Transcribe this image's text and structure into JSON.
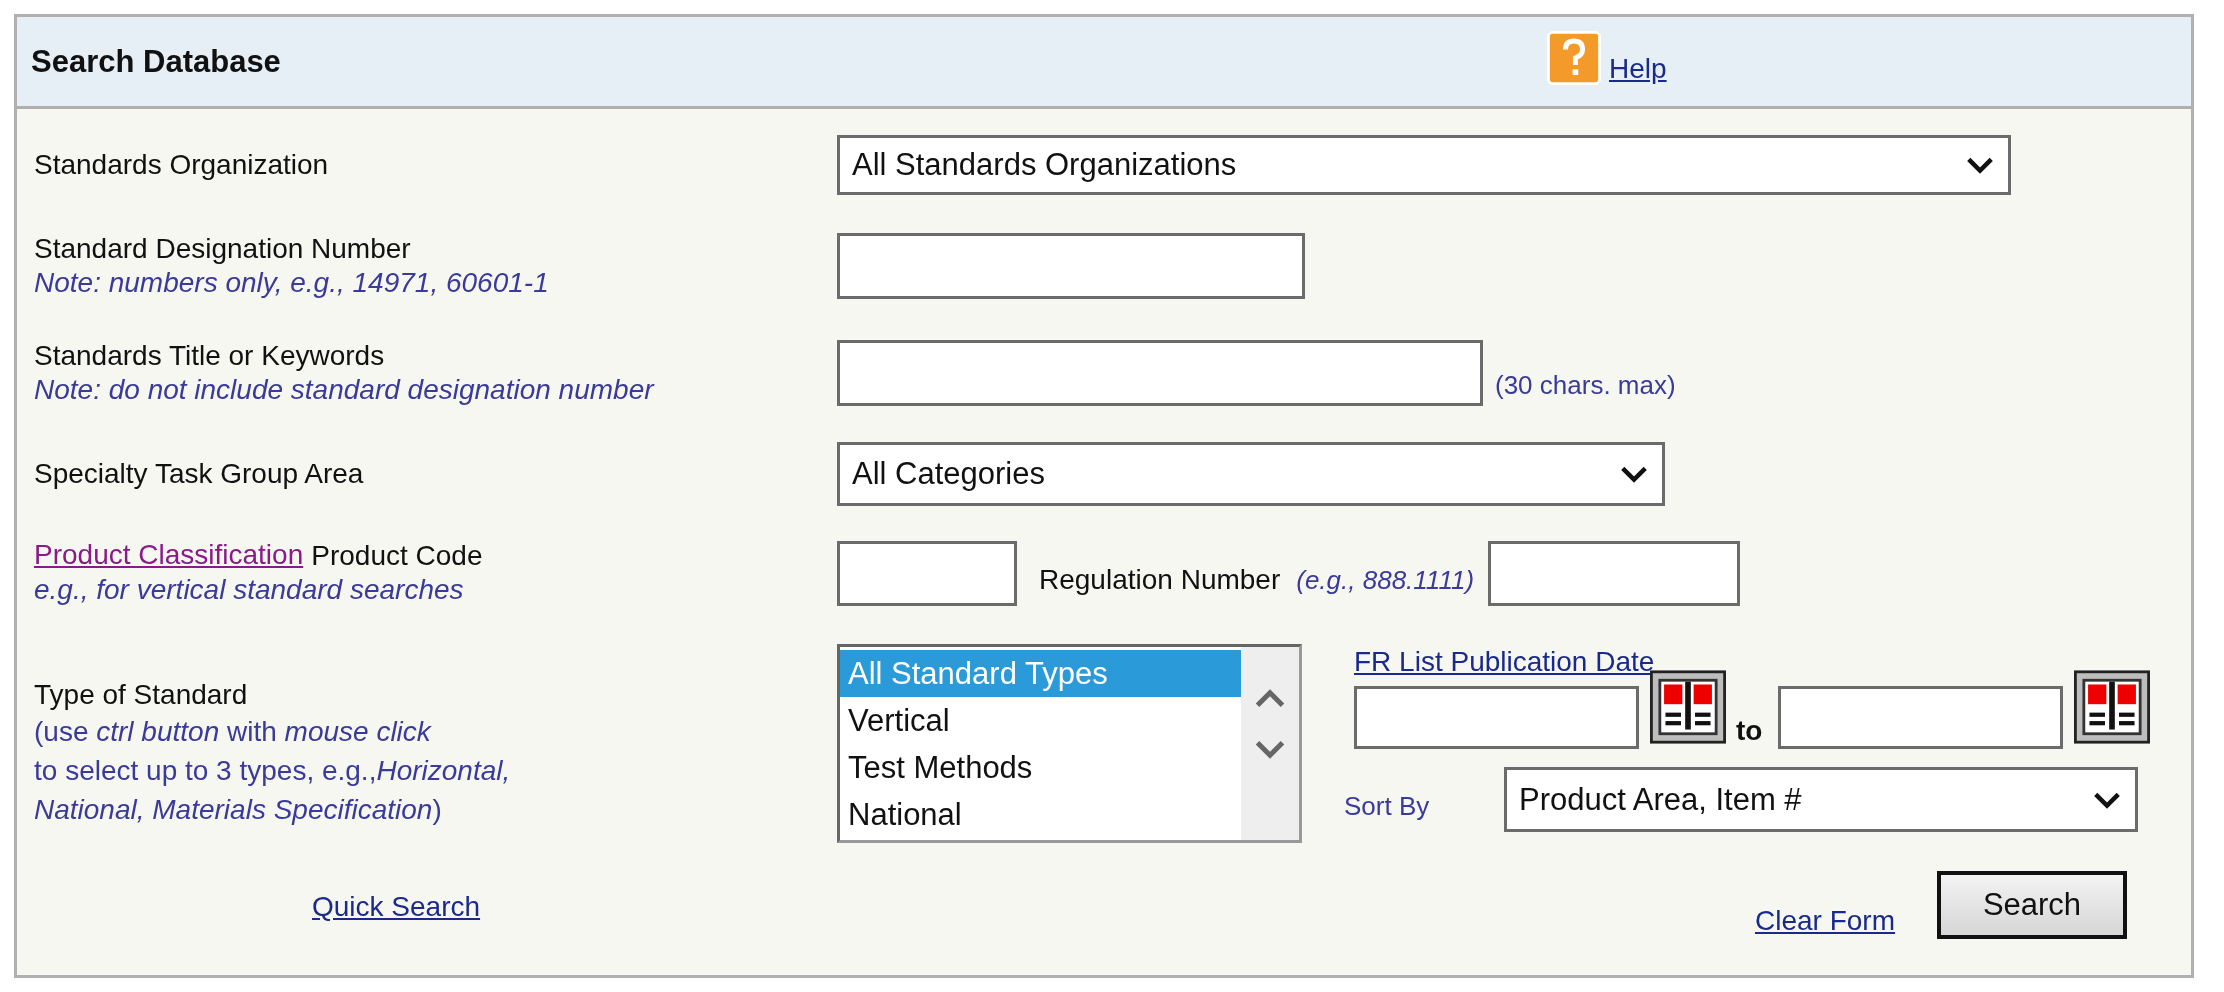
{
  "header": {
    "title": "Search Database",
    "help": "Help"
  },
  "organization": {
    "label": "Standards Organization",
    "value": "All Standards Organizations"
  },
  "designation": {
    "label": "Standard Designation Number",
    "note": "Note: numbers only, e.g., 14971, 60601-1"
  },
  "keywords": {
    "label": "Standards Title or Keywords",
    "note": "Note: do not include standard designation number",
    "limit": "(30 chars. max)"
  },
  "task_group": {
    "label": "Specialty Task Group Area",
    "value": "All Categories"
  },
  "product": {
    "link": "Product Classification",
    "label": "Product Code",
    "note": "e.g., for vertical standard searches",
    "regulation_label": "Regulation Number",
    "regulation_example": "(e.g., 888.1111)"
  },
  "type_of_standard": {
    "label": "Type of Standard",
    "note_lines": [
      "(use *ctrl button* with *mouse click*",
      "to select up to 3 types, e.g.,*Horizontal,*",
      "*National, Materials Specification*)"
    ],
    "options": [
      {
        "label": "All Standard Types",
        "selected": true
      },
      {
        "label": "Vertical",
        "selected": false
      },
      {
        "label": "Test Methods",
        "selected": false
      },
      {
        "label": "National",
        "selected": false
      }
    ]
  },
  "fr_date": {
    "link": "FR List Publication Date",
    "to": "to"
  },
  "sort": {
    "label": "Sort By",
    "value": "Product Area, Item #"
  },
  "quick_search": "Quick Search",
  "clear_form": "Clear Form",
  "search_button": "Search"
}
